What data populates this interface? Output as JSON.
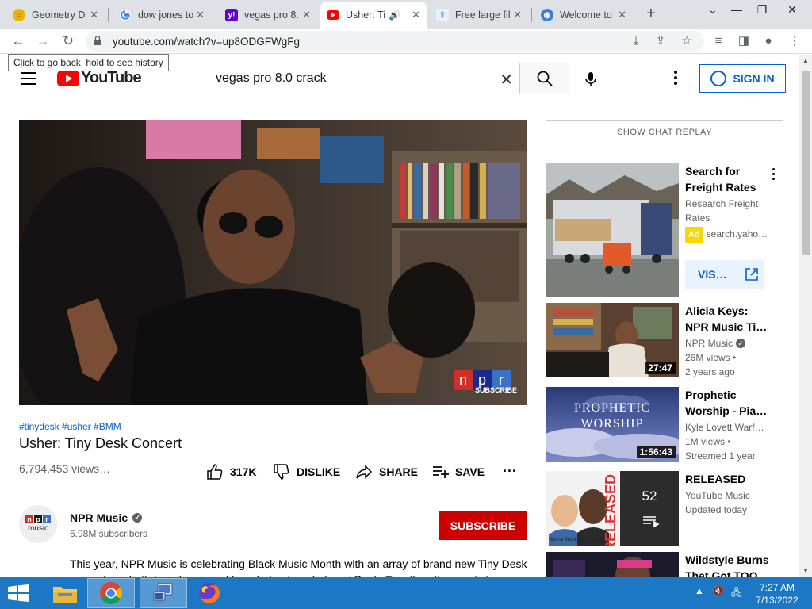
{
  "browser": {
    "tabs": [
      {
        "title": "Geometry D",
        "icon": "geometry-dash-icon"
      },
      {
        "title": "dow jones to",
        "icon": "google-icon"
      },
      {
        "title": "vegas pro 8.",
        "icon": "yahoo-icon"
      },
      {
        "title": "Usher: Ti",
        "icon": "youtube-icon",
        "active": true
      },
      {
        "title": "Free large fil",
        "icon": "upload-icon"
      },
      {
        "title": "Welcome to",
        "icon": "welcome-icon"
      }
    ],
    "url": "youtube.com/watch?v=up8ODGFWgFg",
    "back_tooltip": "Click to go back, hold to see history"
  },
  "youtube": {
    "logo_text": "YouTube",
    "search_value": "vegas pro 8.0 crack",
    "sign_in": "SIGN IN"
  },
  "video": {
    "overlay_brand": "npr",
    "overlay_sub": "SUBSCRIBE",
    "hashtags": "#tinydesk #usher #BMM",
    "title": "Usher: Tiny Desk Concert",
    "views": "6,794,453 views…",
    "likes": "317K",
    "dislike": "DISLIKE",
    "share": "SHARE",
    "save": "SAVE",
    "channel": {
      "name": "NPR Music",
      "avatar_top": "npr",
      "avatar_bottom": "music",
      "subscribers": "6.98M subscribers",
      "subscribe": "SUBSCRIBE"
    },
    "description": "This year, NPR Music is celebrating Black Music Month with an array of brand new Tiny Desk concerts — both from home and from behind our beloved Desk. Together, these artists"
  },
  "sidebar": {
    "chat_replay": "SHOW CHAT REPLAY",
    "ad": {
      "title": "Search for Freight Rates",
      "desc": "Research Freight Rates",
      "badge": "Ad",
      "domain": "search.yaho…",
      "visit": "VIS…"
    },
    "recs": [
      {
        "title": "Alicia Keys: NPR Music Ti…",
        "channel": "NPR Music",
        "views": "26M views •",
        "age": "2 years ago",
        "duration": "27:47"
      },
      {
        "title": "Prophetic Worship - Pia…",
        "channel": "Kyle Lovett Warf…",
        "views": "1M views •",
        "age": "Streamed 1 year",
        "duration": "1:56:43",
        "thumb_text_1": "PROPHETIC",
        "thumb_text_2": "WORSHIP"
      },
      {
        "title": "RELEASED",
        "channel": "YouTube Music",
        "views": "Updated today",
        "playlist_count": "52",
        "thumb_text": "RELEASED",
        "thumb_caption": "Burna Boy & Ed Sheeran"
      },
      {
        "title": "Wildstyle Burns That Got TOO"
      }
    ]
  },
  "taskbar": {
    "time": "7:27 AM",
    "date": "7/13/2022"
  },
  "colors": {
    "youtube_red": "#ff0000",
    "subscribe_red": "#cc0000",
    "link_blue": "#065fd4",
    "taskbar": "#1c78c4"
  }
}
